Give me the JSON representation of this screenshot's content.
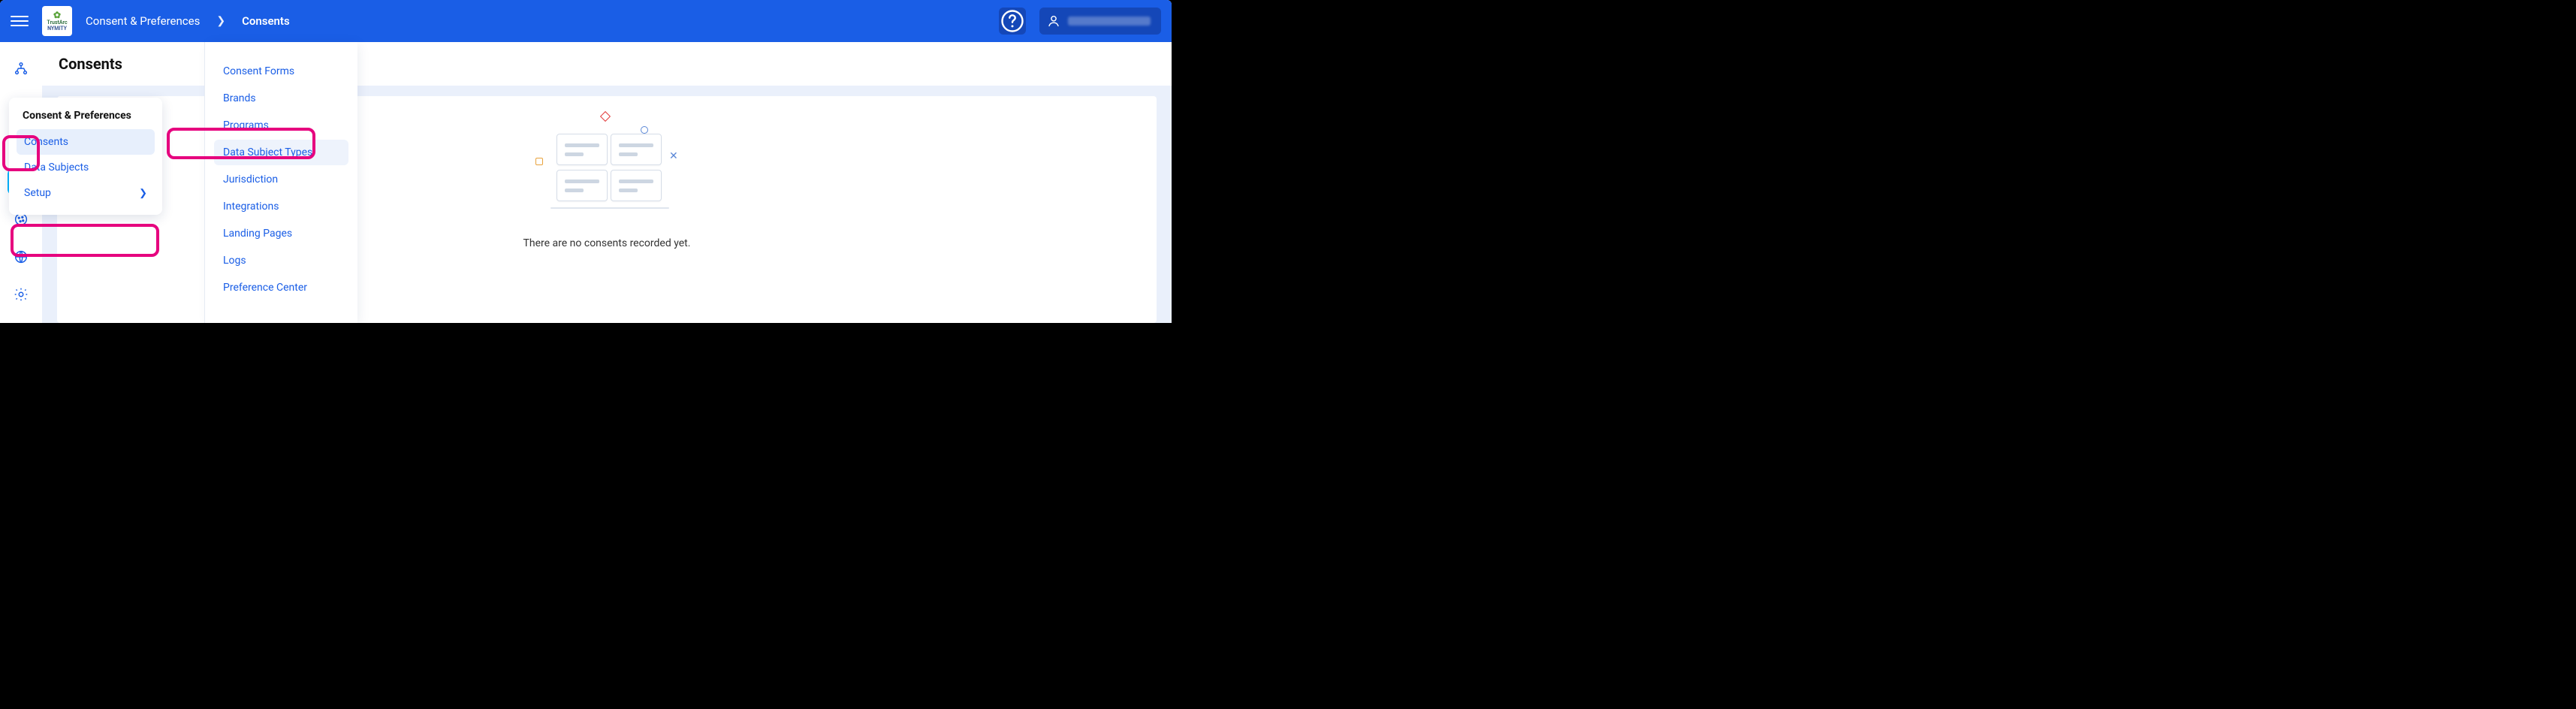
{
  "header": {
    "logo_top": "TrustArc",
    "logo_bottom": "NYMITY",
    "breadcrumb": [
      "Consent & Preferences",
      "Consents"
    ]
  },
  "page": {
    "title": "Consents",
    "empty_message": "There are no consents recorded yet."
  },
  "panel1": {
    "title": "Consent & Preferences",
    "items": [
      {
        "label": "Consents",
        "active": true
      },
      {
        "label": "Data Subjects"
      },
      {
        "label": "Setup",
        "has_children": true
      }
    ]
  },
  "panel2": {
    "items": [
      {
        "label": "Consent Forms"
      },
      {
        "label": "Brands"
      },
      {
        "label": "Programs"
      },
      {
        "label": "Data Subject Types",
        "highlight": true
      },
      {
        "label": "Jurisdiction"
      },
      {
        "label": "Integrations"
      },
      {
        "label": "Landing Pages"
      },
      {
        "label": "Logs"
      },
      {
        "label": "Preference Center"
      }
    ]
  }
}
